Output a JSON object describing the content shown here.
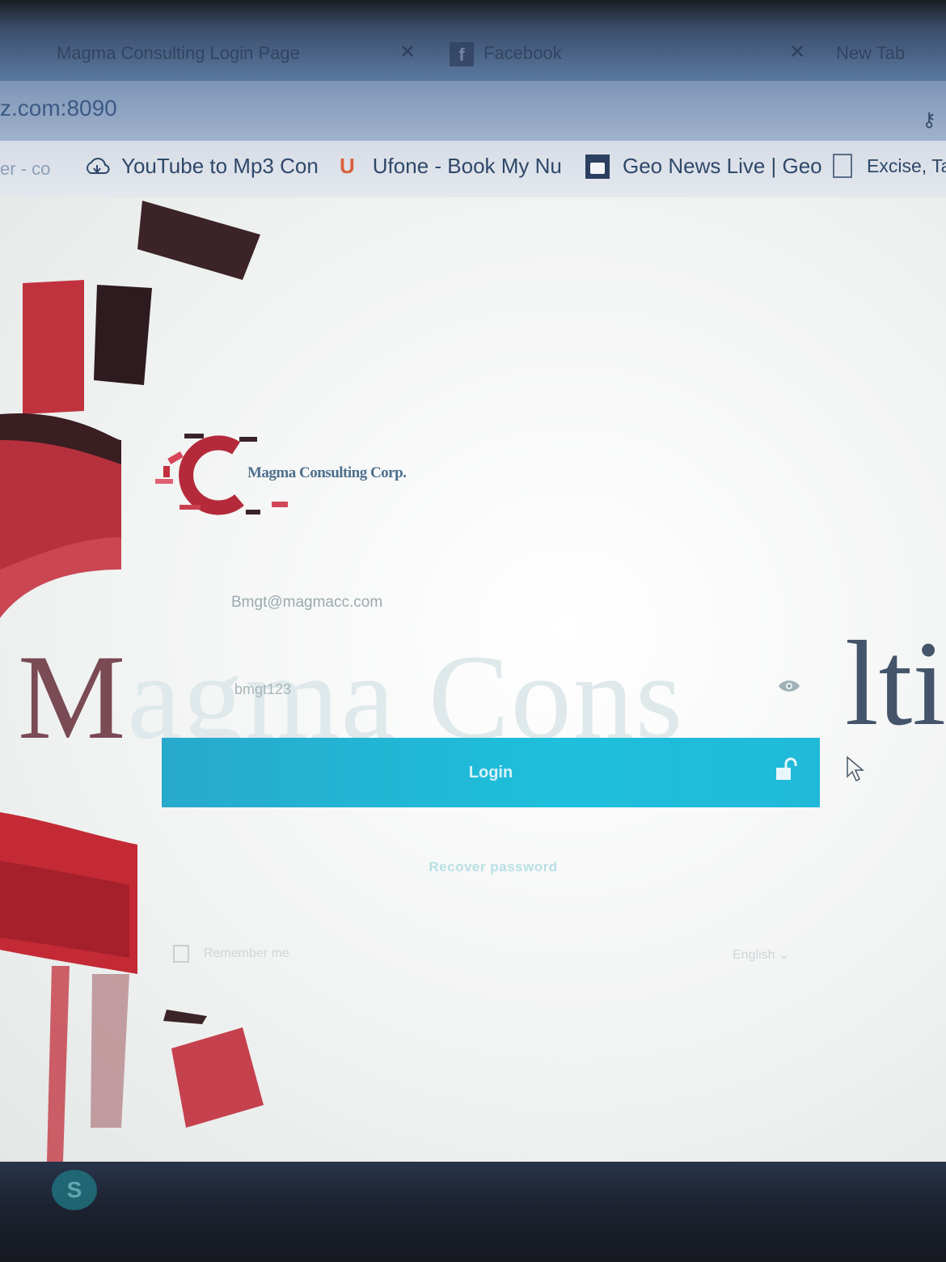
{
  "browser": {
    "tabs": [
      {
        "label": "Magma Consulting Login Page",
        "faded": true
      },
      {
        "label": "Facebook"
      },
      {
        "label": "New Tab"
      }
    ],
    "url": "z.com:8090",
    "bookmarks": [
      {
        "label": "er - co"
      },
      {
        "label": "YouTube to Mp3 Con",
        "icon": "upload-cloud-icon"
      },
      {
        "label": "Ufone - Book My Nu",
        "icon": "ufone-logo"
      },
      {
        "label": "Geo News Live | Geo",
        "icon": "geo-tv-icon"
      },
      {
        "label": "Excise, Ta",
        "icon": "document-icon"
      }
    ]
  },
  "page": {
    "logo_text": "Magma Consulting Corp.",
    "background_word_left": "M",
    "background_word_faded": "agma Cons",
    "background_word_right": "lti",
    "email_value": "Bmgt@magmacc.com",
    "password_value": "bmgt123",
    "login_label": "Login",
    "recover_label": "Recover password",
    "remember_label": "Remember me",
    "language_label": "English"
  },
  "colors": {
    "accent": "#1ebfdc",
    "brand_red": "#c8323a",
    "brand_dark": "#3a1f24"
  }
}
